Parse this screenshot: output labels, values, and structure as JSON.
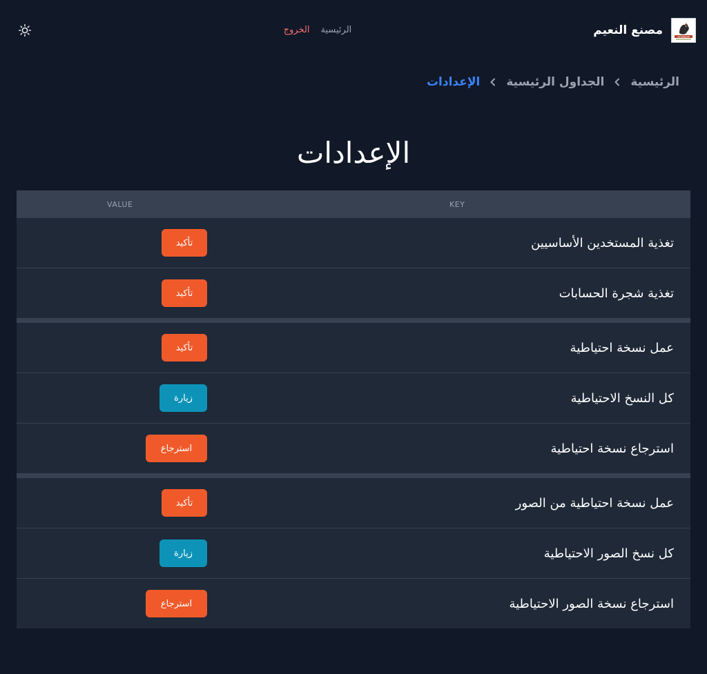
{
  "header": {
    "brand_name": "مصنع النعيم",
    "logo_text": "ALNAEEM",
    "nav": {
      "home": "الرئيسية",
      "logout": "الخروج"
    },
    "theme_icon": "sun-icon"
  },
  "breadcrumb": {
    "items": [
      "الرئيسية",
      "الجداول الرئيسية",
      "الإعدادات"
    ]
  },
  "page": {
    "title": "الإعدادات"
  },
  "table": {
    "headers": {
      "key": "KEY",
      "value": "VALUE"
    },
    "rows": [
      {
        "key": "تغذية المستخدين الأساسيين",
        "action": "تأكيد"
      },
      {
        "key": "تغذية شجرة الحسابات",
        "action": "تأكيد"
      },
      {
        "key": "عمل نسخة احتياطية",
        "action": "تأكيد"
      },
      {
        "key": "كل النسخ الاحتياطية",
        "action": "زيارة"
      },
      {
        "key": "استرجاع نسخة احتياطية",
        "action": "استرجاع"
      },
      {
        "key": "عمل نسخة احتياطية من الصور",
        "action": "تأكيد"
      },
      {
        "key": "كل نسخ الصور الاحتياطية",
        "action": "زيارة"
      },
      {
        "key": "استرجاع نسخة الصور الاحتياطية",
        "action": "استرجاع"
      }
    ]
  },
  "colors": {
    "background": "#111827",
    "table": "#1f2937",
    "header_row": "#374151",
    "accent_blue": "#3b82f6",
    "button_orange": "#f05a2b",
    "button_teal": "#0e93b8",
    "logout_red": "#f87171"
  }
}
